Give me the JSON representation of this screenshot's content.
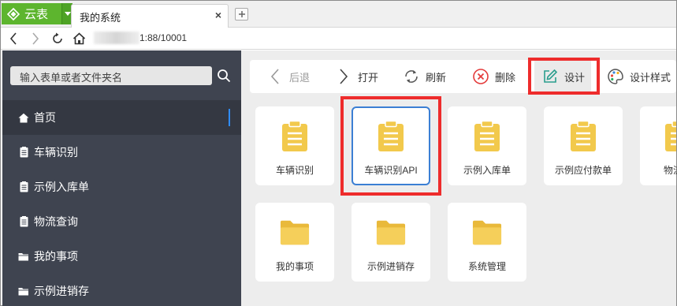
{
  "browser": {
    "brand": "云表",
    "tab_title": "我的系统",
    "tab_close": "×",
    "url": "1:88/10001"
  },
  "sidebar": {
    "search_placeholder": "输入表单或者文件夹名",
    "items": [
      {
        "label": "首页",
        "icon": "home-icon",
        "active": true
      },
      {
        "label": "车辆识别",
        "icon": "document-icon"
      },
      {
        "label": "示例入库单",
        "icon": "document-icon"
      },
      {
        "label": "物流查询",
        "icon": "document-icon"
      },
      {
        "label": "我的事项",
        "icon": "folder-icon"
      },
      {
        "label": "示例进销存",
        "icon": "folder-icon"
      }
    ]
  },
  "toolbar": {
    "back": "后退",
    "open": "打开",
    "refresh": "刷新",
    "delete": "删除",
    "design": "设计",
    "design_style": "设计样式"
  },
  "tiles": [
    {
      "label": "车辆识别",
      "icon": "clipboard-icon"
    },
    {
      "label": "车辆识别API",
      "icon": "clipboard-icon",
      "selected": true
    },
    {
      "label": "示例入库单",
      "icon": "clipboard-icon"
    },
    {
      "label": "示例应付款单",
      "icon": "clipboard-icon"
    },
    {
      "label": "物流",
      "icon": "clipboard-icon"
    },
    {
      "label": "我的事项",
      "icon": "folder-icon"
    },
    {
      "label": "示例进销存",
      "icon": "folder-icon"
    },
    {
      "label": "系统管理",
      "icon": "folder-icon"
    }
  ],
  "colors": {
    "brand_green": "#5db52e",
    "sidebar_bg": "#3f4450",
    "highlight_red": "#ee2c2c",
    "icon_yellow": "#f2c94c",
    "selected_blue": "#3b7fd4"
  }
}
